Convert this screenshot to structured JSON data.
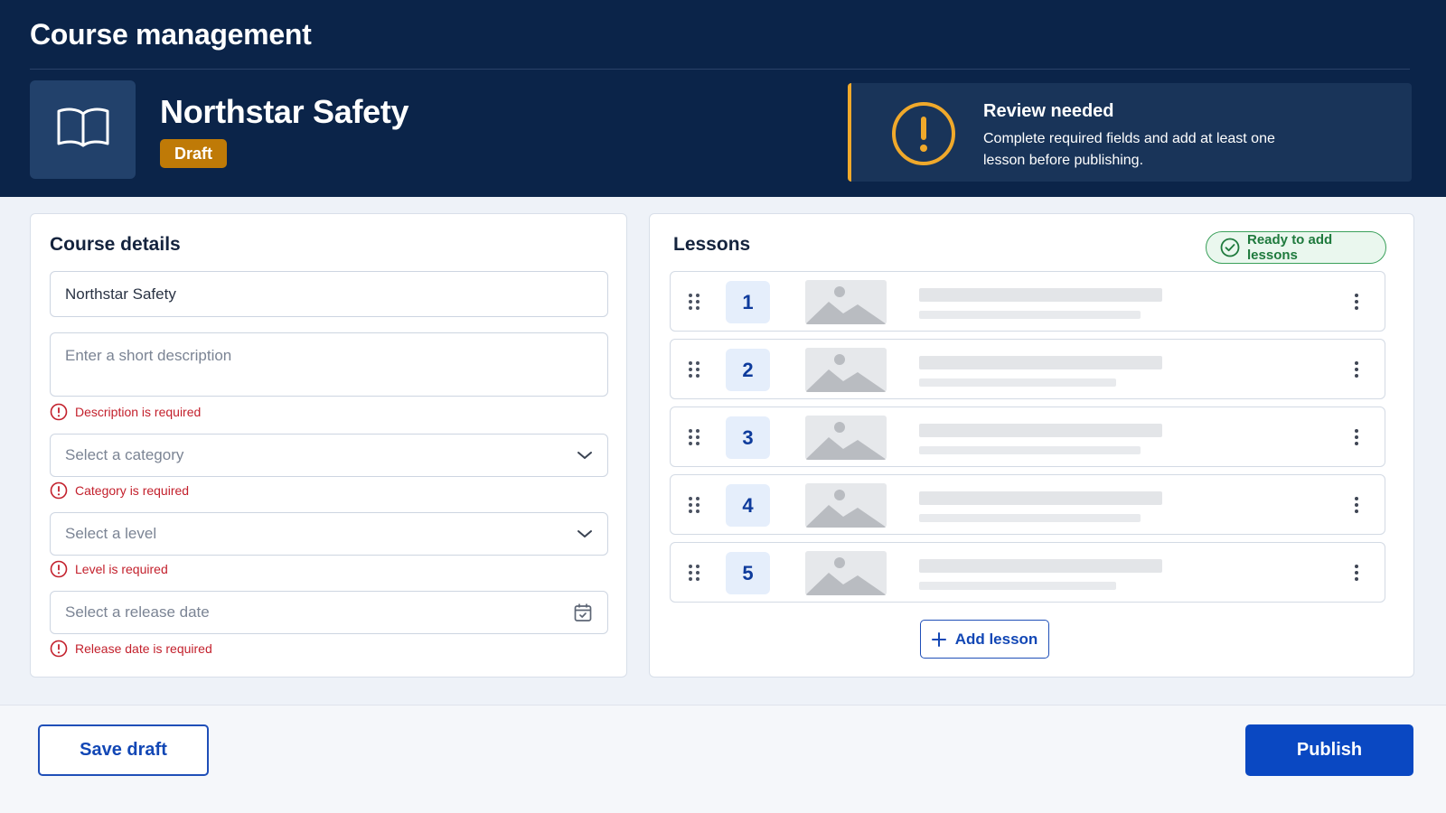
{
  "header": {
    "app_title": "Course management",
    "course_name": "Northstar Safety",
    "status_badge": "Draft",
    "course_icon": "book-icon",
    "review": {
      "icon": "warning-icon",
      "title": "Review needed",
      "message": "Complete required fields and add at least one lesson before publishing."
    }
  },
  "details": {
    "title": "Course details",
    "name_field": {
      "value": "Northstar Safety"
    },
    "description_field": {
      "placeholder": "Enter a short description",
      "error": "Description is required"
    },
    "category_field": {
      "placeholder": "Select a category",
      "error": "Category is required"
    },
    "level_field": {
      "placeholder": "Select a level",
      "error": "Level is required"
    },
    "release_date_field": {
      "placeholder": "Select a release date",
      "error": "Release date is required"
    }
  },
  "lessons": {
    "title": "Lessons",
    "ready_badge": "Ready to add lessons",
    "items": [
      {
        "number": "1"
      },
      {
        "number": "2"
      },
      {
        "number": "3"
      },
      {
        "number": "4"
      },
      {
        "number": "5"
      }
    ],
    "add_label": "Add lesson"
  },
  "footer": {
    "save_label": "Save draft",
    "publish_label": "Publish"
  },
  "colors": {
    "header_bg": "#0b2449",
    "draft_badge": "#bf7a07",
    "warning_accent": "#f0a92b",
    "error_red": "#c3202c",
    "success_green": "#1f7a3d",
    "primary_blue": "#0a48c2"
  }
}
